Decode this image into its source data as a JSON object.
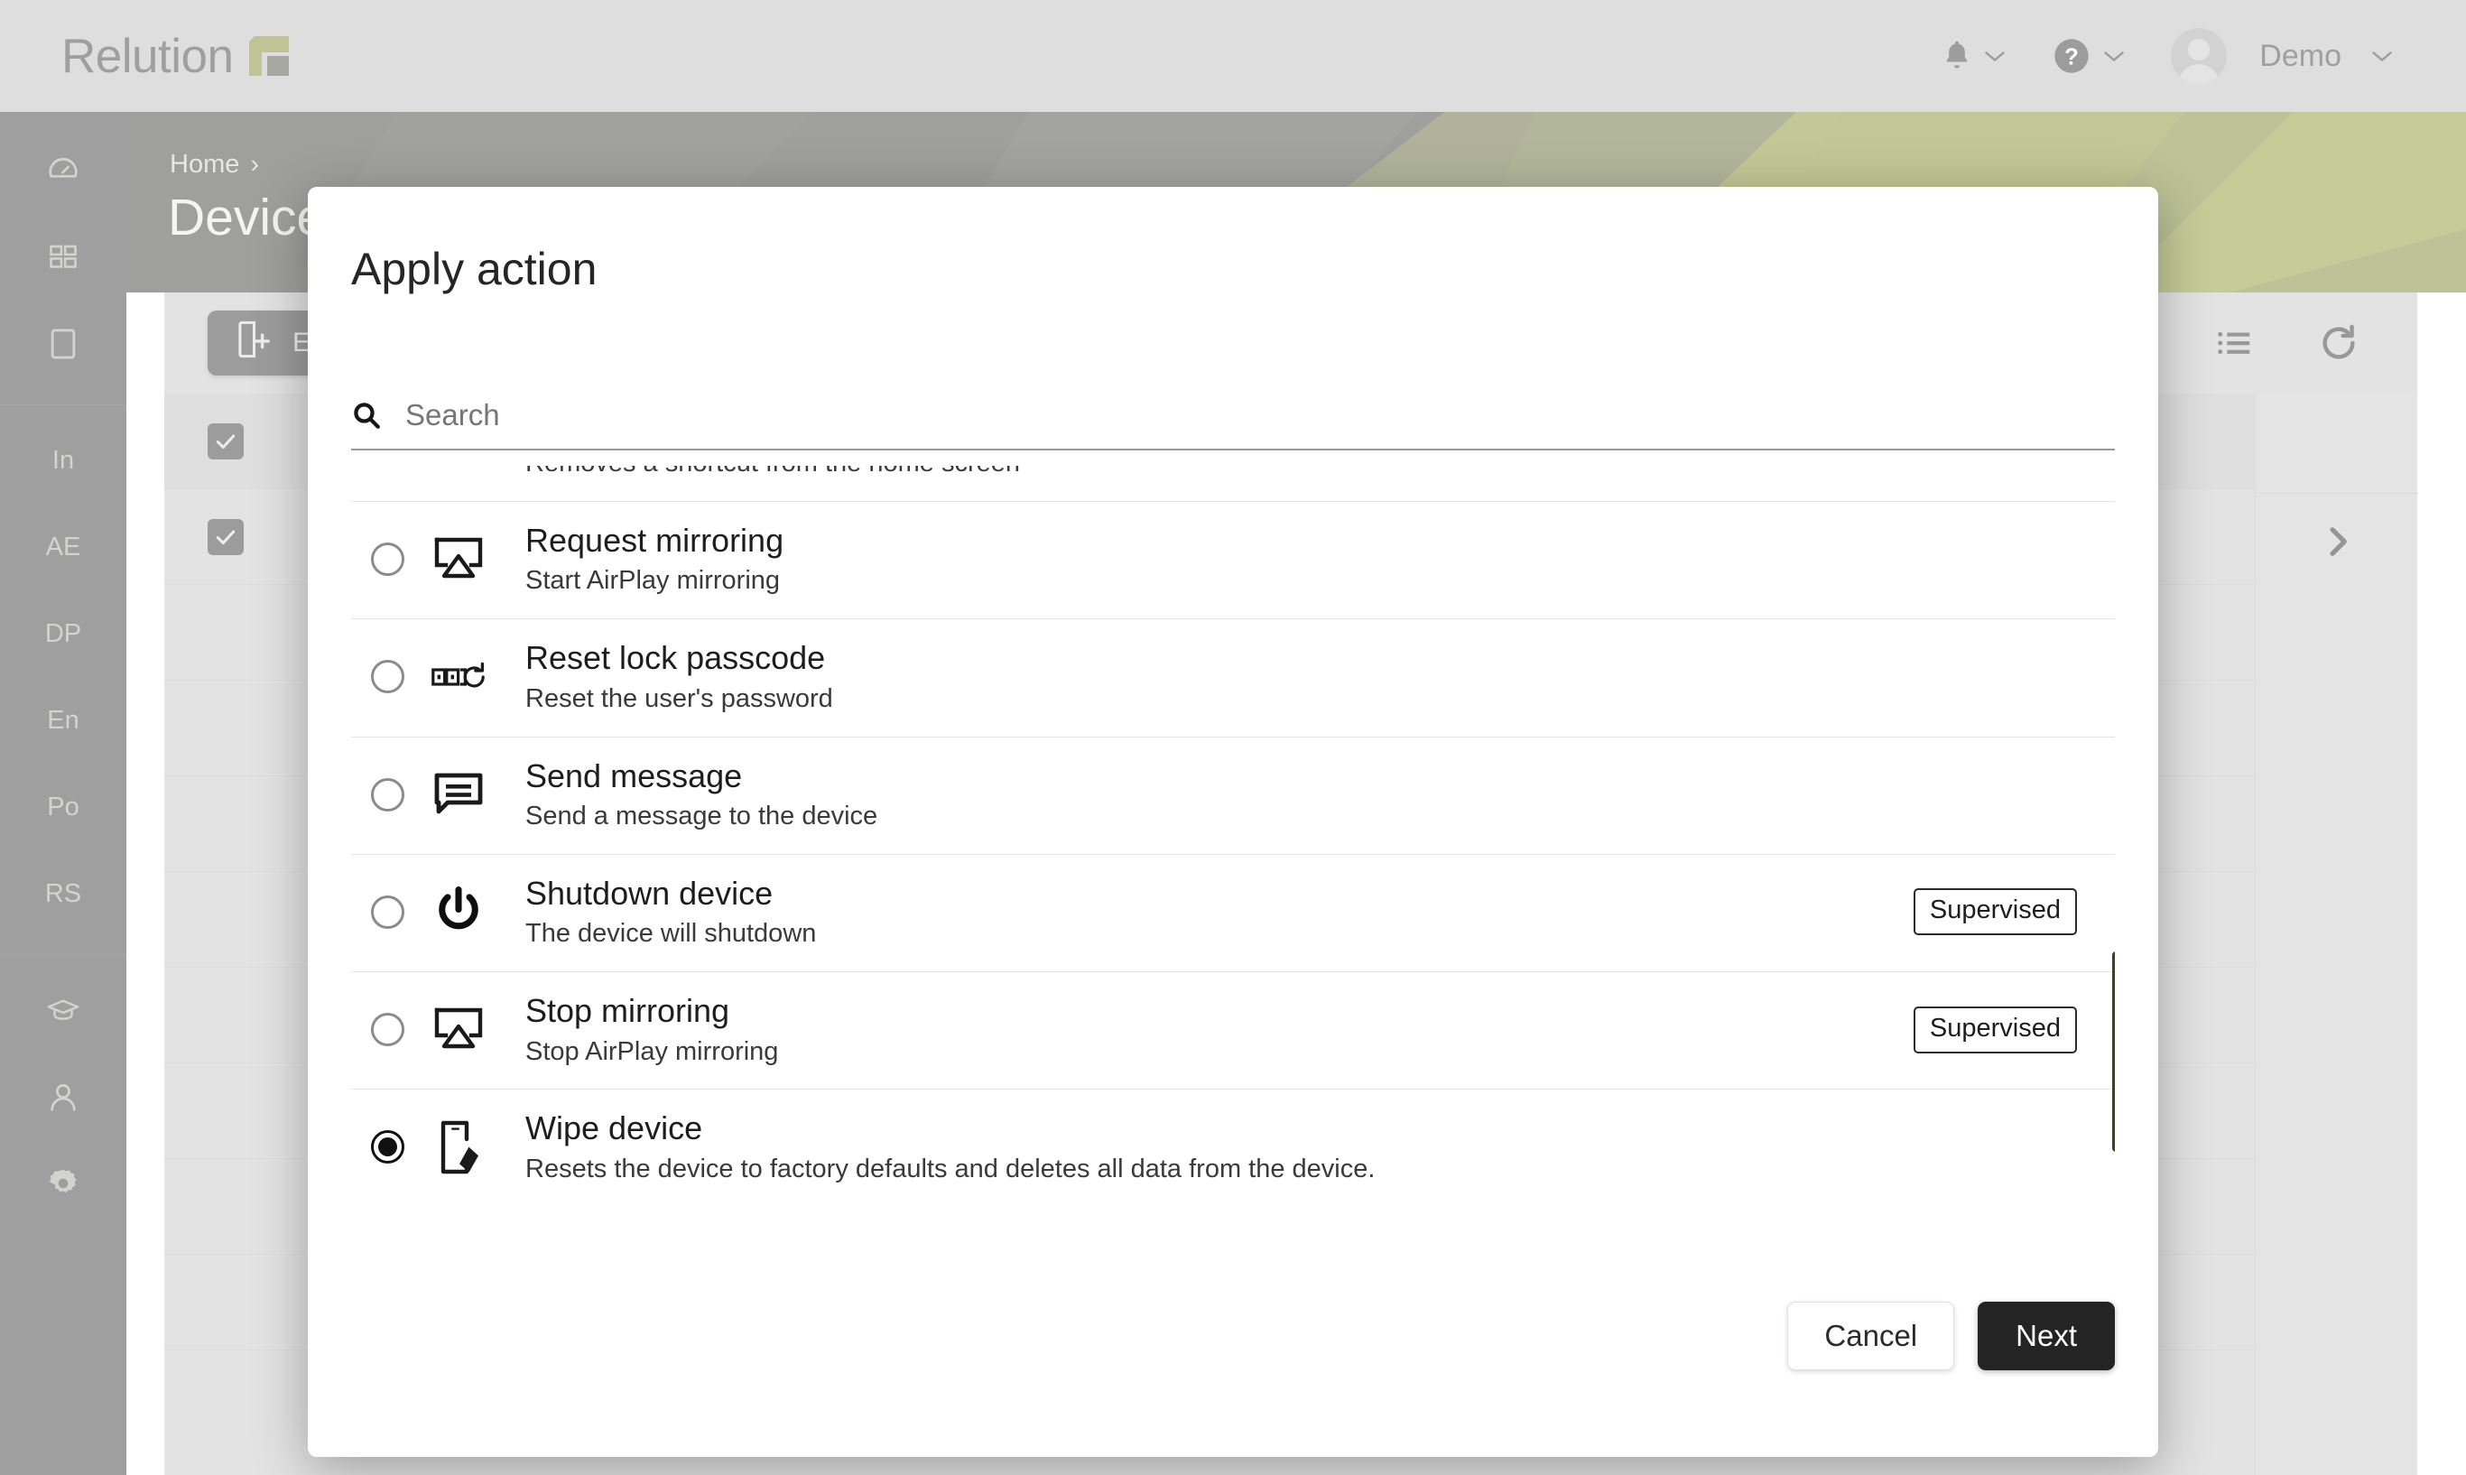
{
  "app": {
    "brand_name": "Relution",
    "brand_accent": "#6f7d17",
    "brand_accent_dark": "#3d3f2d"
  },
  "topbar": {
    "notifications_icon": "bell-icon",
    "help_icon": "question-mark-icon",
    "user_name": "Demo",
    "chevron_icon": "chevron-down-icon"
  },
  "sidebar": {
    "items": [
      {
        "id": "dashboard",
        "icon": "gauge-icon",
        "label": ""
      },
      {
        "id": "apps",
        "icon": "grid-icon",
        "label": ""
      },
      {
        "id": "devices",
        "icon": "tablet-icon",
        "label": ""
      },
      {
        "id": "in",
        "icon": "text-icon",
        "label": "In"
      },
      {
        "id": "ae",
        "icon": "text-icon",
        "label": "AE"
      },
      {
        "id": "dp",
        "icon": "text-icon",
        "label": "DP"
      },
      {
        "id": "en",
        "icon": "text-icon",
        "label": "En"
      },
      {
        "id": "po",
        "icon": "text-icon",
        "label": "Po"
      },
      {
        "id": "rs",
        "icon": "text-icon",
        "label": "RS"
      },
      {
        "id": "education",
        "icon": "graduation-cap-icon",
        "label": ""
      },
      {
        "id": "users",
        "icon": "person-icon",
        "label": ""
      },
      {
        "id": "settings",
        "icon": "gear-icon",
        "label": ""
      }
    ]
  },
  "page": {
    "breadcrumb_home": "Home",
    "breadcrumb_separator": "›",
    "title": "Devices"
  },
  "toolbar": {
    "enroll_label": "En",
    "enroll_icon": "device-add-icon",
    "filter_icon": "funnel-icon",
    "columns_icon": "list-icon",
    "refresh_icon": "refresh-icon",
    "expand_icon": "chevron-right-icon"
  },
  "modal": {
    "title": "Apply action",
    "search": {
      "placeholder": "Search",
      "value": "",
      "icon": "search-icon"
    },
    "clipped_top_text": "Removes a shortcut from the home screen",
    "actions": [
      {
        "id": "request-mirroring",
        "title": "Request mirroring",
        "desc": "Start AirPlay mirroring",
        "icon": "airplay-icon",
        "badge": "",
        "selected": false
      },
      {
        "id": "reset-lock-passcode",
        "title": "Reset lock passcode",
        "desc": "Reset the user's password",
        "icon": "passcode-reset-icon",
        "badge": "",
        "selected": false
      },
      {
        "id": "send-message",
        "title": "Send message",
        "desc": "Send a message to the device",
        "icon": "message-icon",
        "badge": "",
        "selected": false
      },
      {
        "id": "shutdown-device",
        "title": "Shutdown device",
        "desc": "The device will shutdown",
        "icon": "power-icon",
        "badge": "Supervised",
        "selected": false
      },
      {
        "id": "stop-mirroring",
        "title": "Stop mirroring",
        "desc": "Stop AirPlay mirroring",
        "icon": "airplay-icon",
        "badge": "Supervised",
        "selected": false
      },
      {
        "id": "wipe-device",
        "title": "Wipe device",
        "desc": "Resets the device to factory defaults and deletes all data from the device.",
        "icon": "wipe-device-icon",
        "badge": "",
        "selected": true
      }
    ],
    "cancel_label": "Cancel",
    "next_label": "Next"
  }
}
